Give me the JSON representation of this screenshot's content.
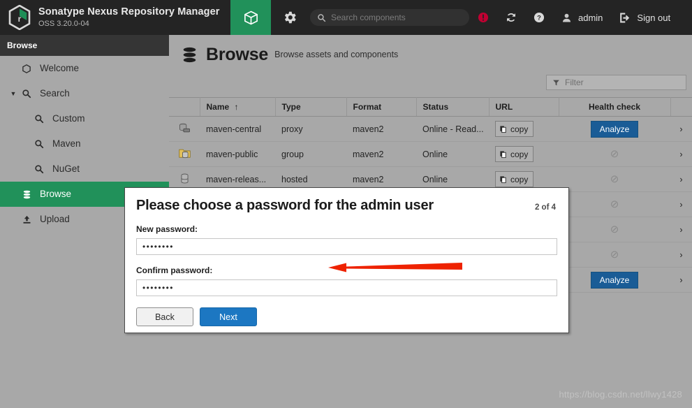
{
  "header": {
    "brand_title": "Sonatype Nexus Repository Manager",
    "brand_version": "OSS 3.20.0-04",
    "logo_icon": "nexus-hex-logo-icon",
    "active_tab_icon": "cube-icon",
    "gear_icon": "gear-icon",
    "search": {
      "icon": "search-icon",
      "placeholder": "Search components",
      "value": ""
    },
    "alert_icon": "alert-circle-icon",
    "refresh_icon": "refresh-icon",
    "help_icon": "help-circle-icon",
    "user_icon": "user-icon",
    "user_label": "admin",
    "signout_icon": "sign-out-icon",
    "signout_label": "Sign out"
  },
  "sidebar": {
    "heading": "Browse",
    "items": [
      {
        "label": "Welcome",
        "icon": "hexagon-icon",
        "level": 0,
        "selected": false,
        "caret": ""
      },
      {
        "label": "Search",
        "icon": "search-icon",
        "level": 0,
        "selected": false,
        "caret": "▼"
      },
      {
        "label": "Custom",
        "icon": "search-icon",
        "level": 1,
        "selected": false,
        "caret": ""
      },
      {
        "label": "Maven",
        "icon": "search-icon",
        "level": 1,
        "selected": false,
        "caret": ""
      },
      {
        "label": "NuGet",
        "icon": "search-icon",
        "level": 1,
        "selected": false,
        "caret": ""
      },
      {
        "label": "Browse",
        "icon": "database-icon",
        "level": 0,
        "selected": true,
        "caret": ""
      },
      {
        "label": "Upload",
        "icon": "upload-icon",
        "level": 0,
        "selected": false,
        "caret": ""
      }
    ]
  },
  "main": {
    "page_icon": "database-icon",
    "page_title": "Browse",
    "page_subtitle": "Browse assets and components",
    "filter": {
      "icon": "funnel-icon",
      "placeholder": "Filter",
      "value": ""
    },
    "table": {
      "columns": [
        "",
        "Name",
        "Type",
        "Format",
        "Status",
        "URL",
        "Health check",
        ""
      ],
      "sort_column": "Name",
      "sort_indicator": "↑",
      "copy_label": "copy",
      "copy_icon": "copy-icon",
      "analyze_label": "Analyze",
      "disabled_icon": "⊘",
      "row_chevron": "›",
      "rows": [
        {
          "icon": "repo-proxy-icon",
          "name": "maven-central",
          "type": "proxy",
          "format": "maven2",
          "status": "Online - Read...",
          "url": "copy",
          "health": "Analyze"
        },
        {
          "icon": "repo-group-icon",
          "name": "maven-public",
          "type": "group",
          "format": "maven2",
          "status": "Online",
          "url": "copy",
          "health": "disabled"
        },
        {
          "icon": "repo-hosted-icon",
          "name": "maven-releas...",
          "type": "hosted",
          "format": "maven2",
          "status": "Online",
          "url": "copy",
          "health": "disabled"
        },
        {
          "icon": "repo-hosted-icon",
          "name": "",
          "type": "",
          "format": "",
          "status": "",
          "url": "",
          "health": "disabled"
        },
        {
          "icon": "repo-hosted-icon",
          "name": "",
          "type": "",
          "format": "",
          "status": "",
          "url": "",
          "health": "disabled"
        },
        {
          "icon": "repo-hosted-icon",
          "name": "",
          "type": "",
          "format": "",
          "status": "",
          "url": "",
          "health": "disabled"
        },
        {
          "icon": "repo-proxy-icon",
          "name": "",
          "type": "",
          "format": "",
          "status": "",
          "url": "",
          "health": "Analyze"
        }
      ]
    }
  },
  "modal": {
    "title": "Please choose a password for the admin user",
    "step": "2 of 4",
    "new_password_label": "New password:",
    "new_password_value": "••••••••",
    "confirm_password_label": "Confirm password:",
    "confirm_password_value": "••••••••",
    "back_label": "Back",
    "next_label": "Next"
  },
  "annotation": {
    "arrow_icon": "red-arrow-left-icon",
    "color": "#ee2200"
  },
  "watermark": "https://blog.csdn.net/llwy1428",
  "colors": {
    "header_bg": "#242424",
    "accent_green": "#21915a",
    "page_bg": "#a8a8a8",
    "primary_blue": "#1c77c2",
    "analyze_blue": "#1a5c96",
    "alert_red": "#c00032"
  }
}
